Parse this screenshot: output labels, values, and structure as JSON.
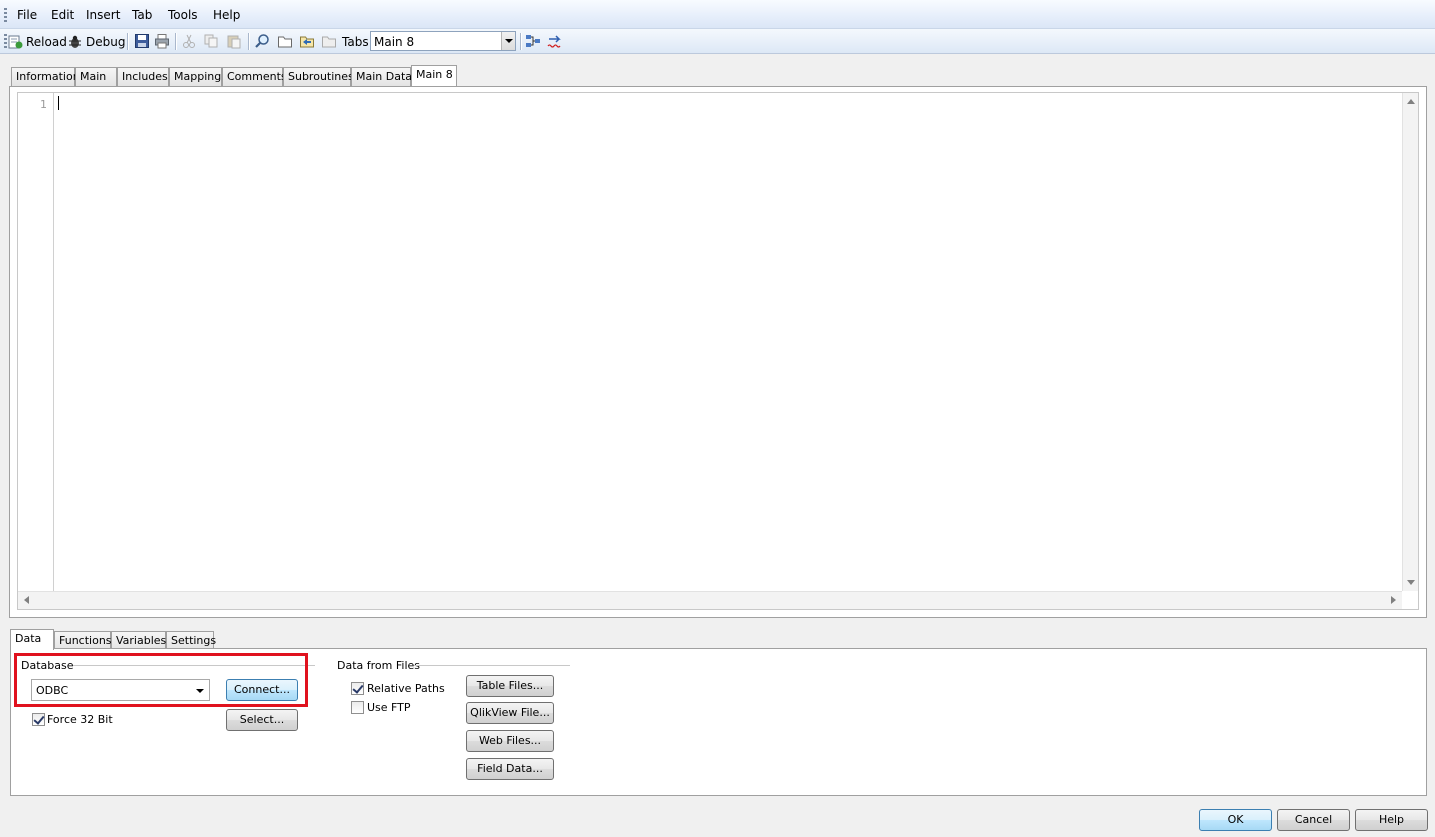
{
  "menu": [
    "File",
    "Edit",
    "Insert",
    "Tab",
    "Tools",
    "Help"
  ],
  "toolbar": {
    "reload": "Reload",
    "debug": "Debug",
    "tabs_label": "Tabs",
    "tabs_select_value": "Main 8"
  },
  "script_tabs": [
    "Information",
    "Main",
    "Includes",
    "Mapping",
    "Comments",
    "Subroutines",
    "Main Data",
    "Main 8"
  ],
  "editor": {
    "line_number": "1"
  },
  "bottom_tabs": [
    "Data",
    "Functions",
    "Variables",
    "Settings"
  ],
  "database": {
    "group_label": "Database",
    "selected": "ODBC",
    "connect": "Connect...",
    "select": "Select...",
    "force32": "Force 32 Bit"
  },
  "files": {
    "group_label": "Data from Files",
    "relative_paths": "Relative Paths",
    "use_ftp": "Use FTP",
    "table_files": "Table Files...",
    "qlikview_file": "QlikView File...",
    "web_files": "Web Files...",
    "field_data": "Field Data..."
  },
  "dialog": {
    "ok": "OK",
    "cancel": "Cancel",
    "help": "Help"
  },
  "colors": {
    "highlight": "#e0121e"
  }
}
